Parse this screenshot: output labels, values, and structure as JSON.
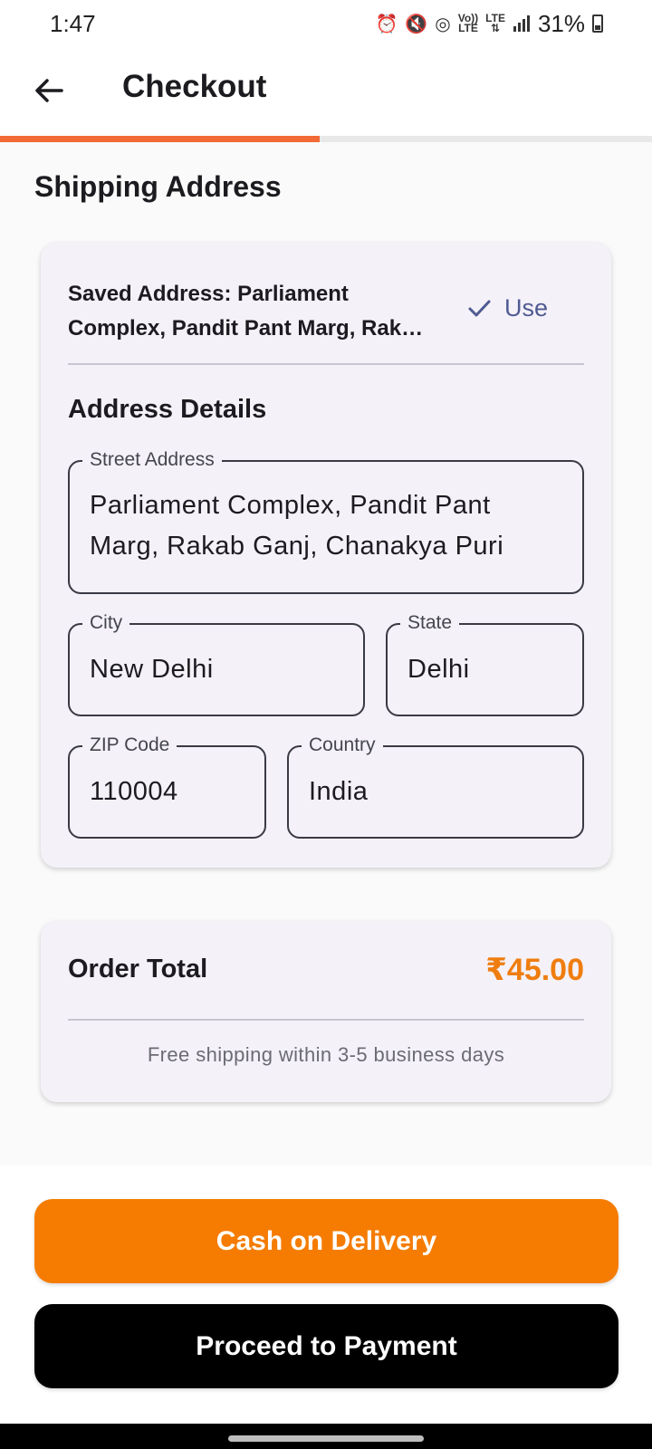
{
  "status_bar": {
    "time": "1:47",
    "battery": "31%",
    "icons": [
      "alarm-icon",
      "mute-icon",
      "hotspot-icon",
      "volte-icon",
      "lte-icon",
      "signal-icon",
      "battery-icon"
    ],
    "volte_top": "Vo))",
    "volte_bottom": "LTE",
    "lte_label": "LTE"
  },
  "app_bar": {
    "title": "Checkout",
    "back_icon": "arrow-left-icon"
  },
  "progress": {
    "fraction": 0.49,
    "color": "#f26a36"
  },
  "shipping": {
    "section_title": "Shipping Address",
    "saved_line1": "Saved Address: Parliament",
    "saved_line2": "Complex, Pandit Pant Marg, Rak…",
    "use_label": "Use",
    "details_title": "Address Details",
    "fields": {
      "street": {
        "label": "Street Address",
        "value": "Parliament Complex, Pandit Pant Marg, Rakab Ganj, Chanakya Puri"
      },
      "city": {
        "label": "City",
        "value": "New Delhi"
      },
      "state": {
        "label": "State",
        "value": "Delhi"
      },
      "zip": {
        "label": "ZIP Code",
        "value": "110004"
      },
      "country": {
        "label": "Country",
        "value": "India"
      }
    }
  },
  "order": {
    "label": "Order Total",
    "total": "₹45.00",
    "note": "Free shipping within 3-5 business days"
  },
  "actions": {
    "cod_label": "Cash on Delivery",
    "pay_label": "Proceed to Payment"
  },
  "colors": {
    "accent": "#f57c00",
    "price": "#ef7d0f",
    "use_button": "#4f5b92",
    "card_bg": "#f4f1f8"
  }
}
